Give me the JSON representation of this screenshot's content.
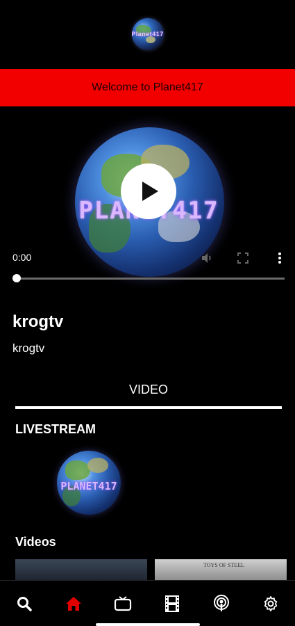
{
  "header": {
    "logo_text": "Planet417",
    "logo_icon": "planet-logo-icon"
  },
  "welcome": {
    "text": "Welcome to Planet417",
    "color": "#f20000"
  },
  "player": {
    "brand_text": "PLANET417",
    "time": "0:00",
    "progress_fraction": 0.0,
    "icons": [
      "play-icon",
      "volume-icon",
      "fullscreen-icon",
      "more-vertical-icon"
    ]
  },
  "channel": {
    "title": "krogtv",
    "subtitle": "krogtv"
  },
  "tabs": [
    {
      "label": "VIDEO",
      "active": true
    }
  ],
  "sections": {
    "livestream_title": "LIVESTREAM",
    "livestream_brand": "PLANET417",
    "videos_title": "Videos"
  },
  "video_thumbs": [
    {
      "caption": ""
    },
    {
      "caption": "TOYS OF STEEL"
    }
  ],
  "bottom_nav": [
    {
      "icon": "search-icon",
      "active": false
    },
    {
      "icon": "home-icon",
      "active": true
    },
    {
      "icon": "tv-icon",
      "active": false
    },
    {
      "icon": "film-icon",
      "active": false
    },
    {
      "icon": "podcast-icon",
      "active": false
    },
    {
      "icon": "gear-icon",
      "active": false
    }
  ],
  "colors": {
    "accent": "#e00000",
    "background": "#000000",
    "text": "#ffffff"
  }
}
